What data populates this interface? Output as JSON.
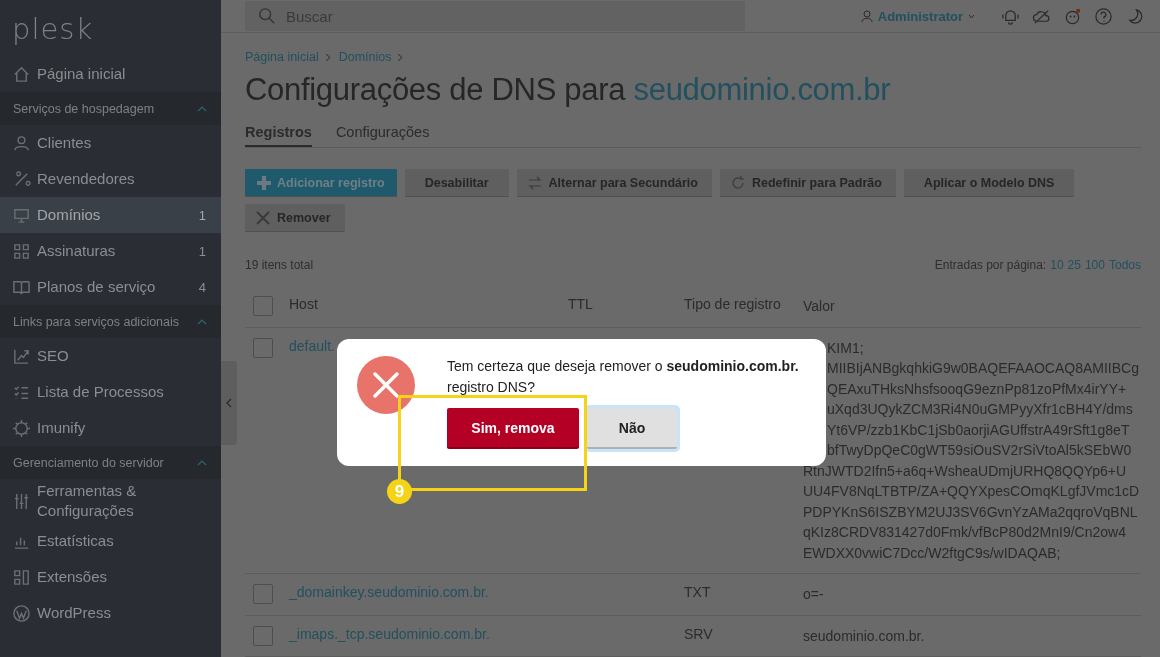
{
  "sidebar": {
    "logo": "plesk",
    "entries": [
      {
        "kind": "item",
        "label": "Página inicial",
        "selected": false
      },
      {
        "kind": "section",
        "label": "Serviços de hospedagem",
        "expanded": true
      },
      {
        "kind": "item",
        "label": "Clientes",
        "selected": false
      },
      {
        "kind": "item",
        "label": "Revendedores",
        "selected": false
      },
      {
        "kind": "item",
        "label": "Domínios",
        "count": "1",
        "selected": true
      },
      {
        "kind": "item",
        "label": "Assinaturas",
        "count": "1",
        "selected": false
      },
      {
        "kind": "item",
        "label": "Planos de serviço",
        "count": "4",
        "selected": false
      },
      {
        "kind": "section",
        "label": "Links para serviços adicionais",
        "expanded": true
      },
      {
        "kind": "item",
        "label": "SEO",
        "selected": false
      },
      {
        "kind": "item",
        "label": "Lista de Processos",
        "selected": false
      },
      {
        "kind": "item",
        "label": "Imunify",
        "selected": false
      },
      {
        "kind": "section",
        "label": "Gerenciamento do servidor",
        "expanded": true
      },
      {
        "kind": "item",
        "label": "Ferramentas & Configurações",
        "selected": false
      },
      {
        "kind": "item",
        "label": "Estatísticas",
        "selected": false
      },
      {
        "kind": "item",
        "label": "Extensões",
        "selected": false
      },
      {
        "kind": "item",
        "label": "WordPress",
        "selected": false
      }
    ]
  },
  "header": {
    "search": {
      "placeholder": "Buscar"
    },
    "user": "Administrator"
  },
  "breadcrumbs": [
    "Página inicial",
    "Domínios"
  ],
  "title": {
    "text": "Configurações de DNS para ",
    "domain": "seudominio.com.br"
  },
  "tabs": [
    {
      "label": "Registros",
      "selected": true
    },
    {
      "label": "Configurações",
      "selected": false
    }
  ],
  "toolbar": [
    {
      "label": "Adicionar registro",
      "kind": "primary"
    },
    {
      "label": "Desabilitar",
      "kind": "plain"
    },
    {
      "label": "Alternar para Secundário",
      "kind": "switch"
    },
    {
      "label": "Redefinir para Padrão",
      "kind": "reset"
    },
    {
      "label": "Aplicar o Modelo DNS",
      "kind": "plain"
    },
    {
      "label": "Remover",
      "kind": "remove"
    }
  ],
  "total": "19 itens total",
  "per_page": {
    "label": "Entradas por página:",
    "options": [
      {
        "label": "10",
        "selected": false
      },
      {
        "label": "25",
        "selected": false
      },
      {
        "label": "100",
        "selected": false
      },
      {
        "label": "Todos",
        "selected": false
      }
    ]
  },
  "table": {
    "select_all": {
      "checked": false
    },
    "columns": [
      "Host",
      "TTL",
      "Tipo de registro",
      "Valor"
    ],
    "rows": [
      {
        "host": "default.",
        "checked": false,
        "value": [
          {
            "text": "KIM1;",
            "covered": true
          },
          {
            "text": "MIIBIjANBgkqhkiG9w0BAQEFAAOCAQ8AMIIBCg",
            "covered": true
          },
          {
            "text": "QEAxuTHksNhsfsooqG9eznPp81zoPfMx4irYY+",
            "covered": true
          },
          {
            "text": "uXqd3UQykZCM3Ri4N0uGMPyyXfr1cBH4Y/dms",
            "covered": true
          },
          {
            "text": "Yt6VP/zzb1KbC1jSb0aorjiAGUffstrA49rSft1g8eT",
            "covered": true
          },
          {
            "text": "bfTwyDpQeC0gWT59siOuSV2rSiVtoAl5kSEbW0",
            "covered": true
          },
          {
            "text": "RtnJWTD2Ifn5+a6q+WsheaUDmjURHQ8QQYp6+U",
            "covered": false
          },
          {
            "text": "UU4FV8NqLTBTP/ZA+QQYXpesCOmqKLgfJVmc1cD",
            "covered": false
          },
          {
            "text": "PDPYKnS6ISZBYM2UJ3SV6GvnYzAMa2qqroVqBNL",
            "covered": false
          },
          {
            "text": "qKIz8CRDV831427d0Fmk/vfBcP80d2MnI9/Cn2ow4",
            "covered": false
          },
          {
            "text": "EWDXX0vwiC7Dcc/W2ftgC9s/wIDAQAB;",
            "covered": false
          }
        ]
      },
      {
        "host": "_domainkey.seudominio.com.br.",
        "type": "TXT",
        "checked": false,
        "value": [
          {
            "text": "o=-",
            "covered": false
          }
        ]
      },
      {
        "host": "_imaps._tcp.seudominio.com.br.",
        "type": "SRV",
        "checked": false,
        "value": [
          {
            "text": "seudominio.com.br.",
            "covered": false
          }
        ]
      }
    ]
  },
  "dialog": {
    "message": "Tem certeza que deseja remover o **seudominio.com.br.** registro DNS?",
    "confirm": "Sim, remova",
    "cancel": "Não"
  },
  "callout": {
    "number": "9"
  }
}
